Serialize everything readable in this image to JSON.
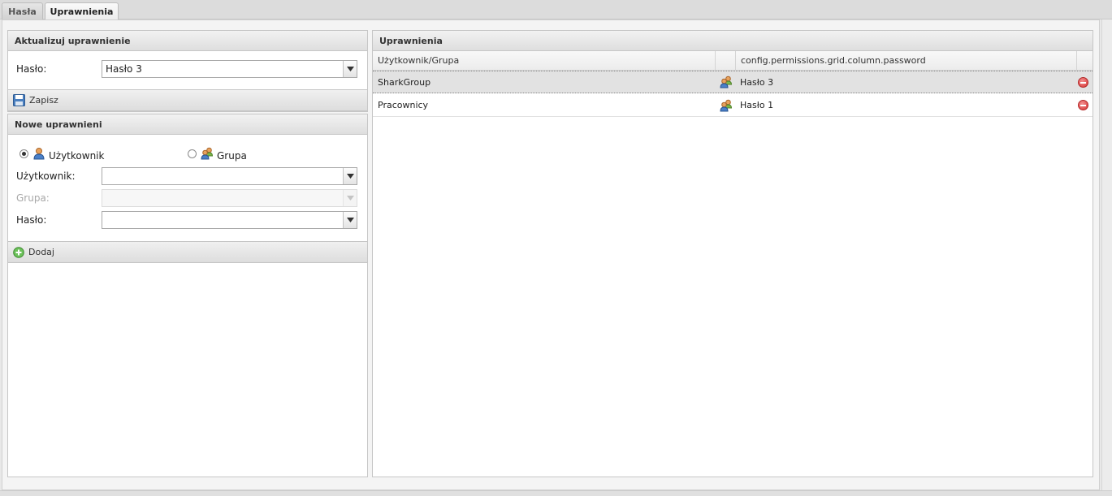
{
  "tabs": [
    {
      "label": "Hasła",
      "active": false
    },
    {
      "label": "Uprawnienia",
      "active": true
    }
  ],
  "update_panel": {
    "title": "Aktualizuj uprawnienie",
    "password_label": "Hasło:",
    "password_value": "Hasło 3",
    "save_label": "Zapisz"
  },
  "new_panel": {
    "title": "Nowe uprawnieni",
    "radio_user_label": "Użytkownik",
    "radio_group_label": "Grupa",
    "radio_selected": "user",
    "user_label": "Użytkownik:",
    "user_value": "",
    "group_label": "Grupa:",
    "group_value": "",
    "password_label": "Hasło:",
    "password_value": "",
    "add_label": "Dodaj"
  },
  "permissions_grid": {
    "title": "Uprawnienia",
    "columns": [
      "Użytkownik/Grupa",
      "",
      "config.permissions.grid.column.password",
      ""
    ],
    "rows": [
      {
        "name": "SharkGroup",
        "type_icon": "group-icon",
        "password": "Hasło 3",
        "selected": true
      },
      {
        "name": "Pracownicy",
        "type_icon": "group-icon",
        "password": "Hasło 1",
        "selected": false
      }
    ]
  },
  "icon_names": [
    "save-icon",
    "add-icon",
    "user-icon",
    "group-icon",
    "remove-icon",
    "chevron-down-icon"
  ]
}
